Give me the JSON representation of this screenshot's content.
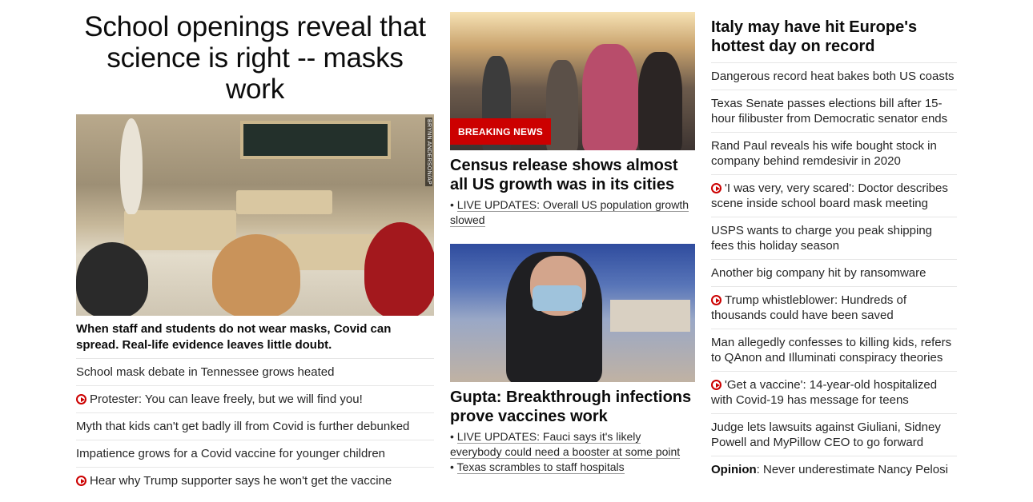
{
  "lead": {
    "title": "School openings reveal that science is right -- masks work",
    "image_credit": "BRYNN ANDERSON/AP",
    "subtitle": "When staff and students do not wear masks, Covid can spread. Real-life evidence leaves little doubt.",
    "links": [
      {
        "text": "School mask debate in Tennessee grows heated",
        "video": false
      },
      {
        "text": "Protester: You can leave freely, but we will find you!",
        "video": true
      },
      {
        "text": "Myth that kids can't get badly ill from Covid is further debunked",
        "video": false
      },
      {
        "text": "Impatience grows for a Covid vaccine for younger children",
        "video": false
      },
      {
        "text": "Hear why Trump supporter says he won't get the vaccine",
        "video": true
      }
    ]
  },
  "census": {
    "badge": "BREAKING NEWS",
    "title": "Census release shows almost all US growth was in its cities",
    "bullets": [
      "LIVE UPDATES: Overall US population growth slowed"
    ]
  },
  "gupta": {
    "title": "Gupta: Breakthrough infections prove vaccines work",
    "bullets": [
      "LIVE UPDATES: Fauci says it's likely everybody could need a booster at some point",
      "Texas scrambles to staff hospitals"
    ]
  },
  "side": {
    "title": "Italy may have hit Europe's hottest day on record",
    "links": [
      {
        "text": "Dangerous record heat bakes both US coasts",
        "video": false
      },
      {
        "text": "Texas Senate passes elections bill after 15-hour filibuster from Democratic senator ends",
        "video": false
      },
      {
        "text": "Rand Paul reveals his wife bought stock in company behind remdesivir in 2020",
        "video": false
      },
      {
        "text": "'I was very, very scared': Doctor describes scene inside school board mask meeting",
        "video": true
      },
      {
        "text": "USPS wants to charge you peak shipping fees this holiday season",
        "video": false
      },
      {
        "text": "Another big company hit by ransomware",
        "video": false
      },
      {
        "text": "Trump whistleblower: Hundreds of thousands could have been saved",
        "video": true
      },
      {
        "text": "Man allegedly confesses to killing kids, refers to QAnon and Illuminati conspiracy theories",
        "video": false
      },
      {
        "text": "'Get a vaccine': 14-year-old hospitalized with Covid-19 has message for teens",
        "video": true
      },
      {
        "text": "Judge lets lawsuits against Giuliani, Sidney Powell and MyPillow CEO to go forward",
        "video": false
      }
    ],
    "opinion": {
      "label": "Opinion",
      "text": ": Never underestimate Nancy Pelosi"
    }
  },
  "colors": {
    "accent": "#cc0000",
    "text": "#262626",
    "divider": "#e6e6e6"
  }
}
